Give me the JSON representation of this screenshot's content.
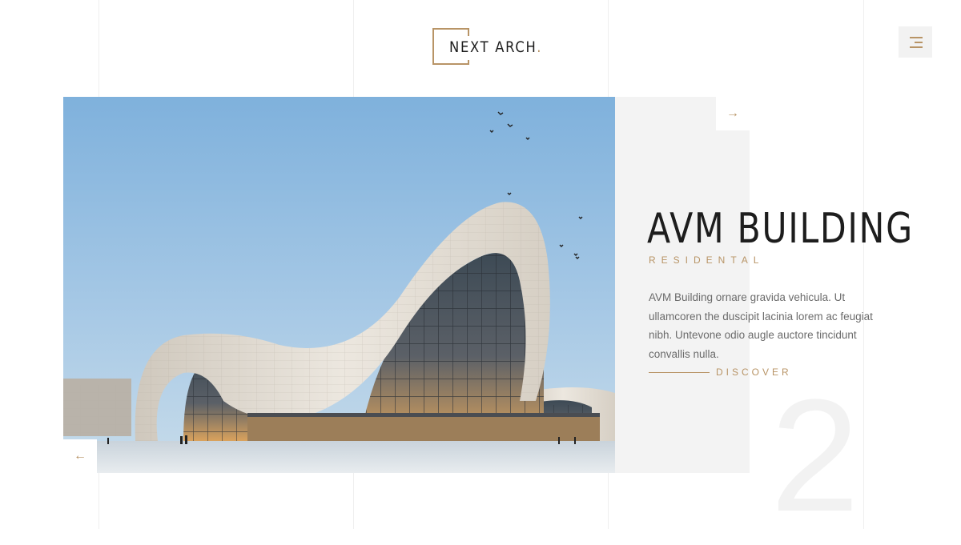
{
  "logo": {
    "text": "NEXT ARCH",
    "dot": "."
  },
  "menu": {
    "icon": "menu-icon"
  },
  "slide": {
    "title": "AVM BUILDING",
    "category": "RESIDENTAL",
    "description": "AVM  Building ornare gravida vehicula. Ut ullamcoren the duscipit lacinia lorem ac feugiat nibh. Untevone odio augle auctore tincidunt convallis nulla.",
    "discover_label": "DISCOVER",
    "number": "2",
    "image_alt": "Curving white modern building against blue sky"
  },
  "navigation": {
    "next_icon": "arrow-right-icon",
    "prev_icon": "arrow-left-icon",
    "next_glyph": "→",
    "prev_glyph": "←"
  },
  "colors": {
    "accent": "#b89466",
    "text": "#1d1d1d",
    "muted": "#6b6b6b",
    "panel": "#f3f3f3",
    "background": "#ffffff"
  }
}
